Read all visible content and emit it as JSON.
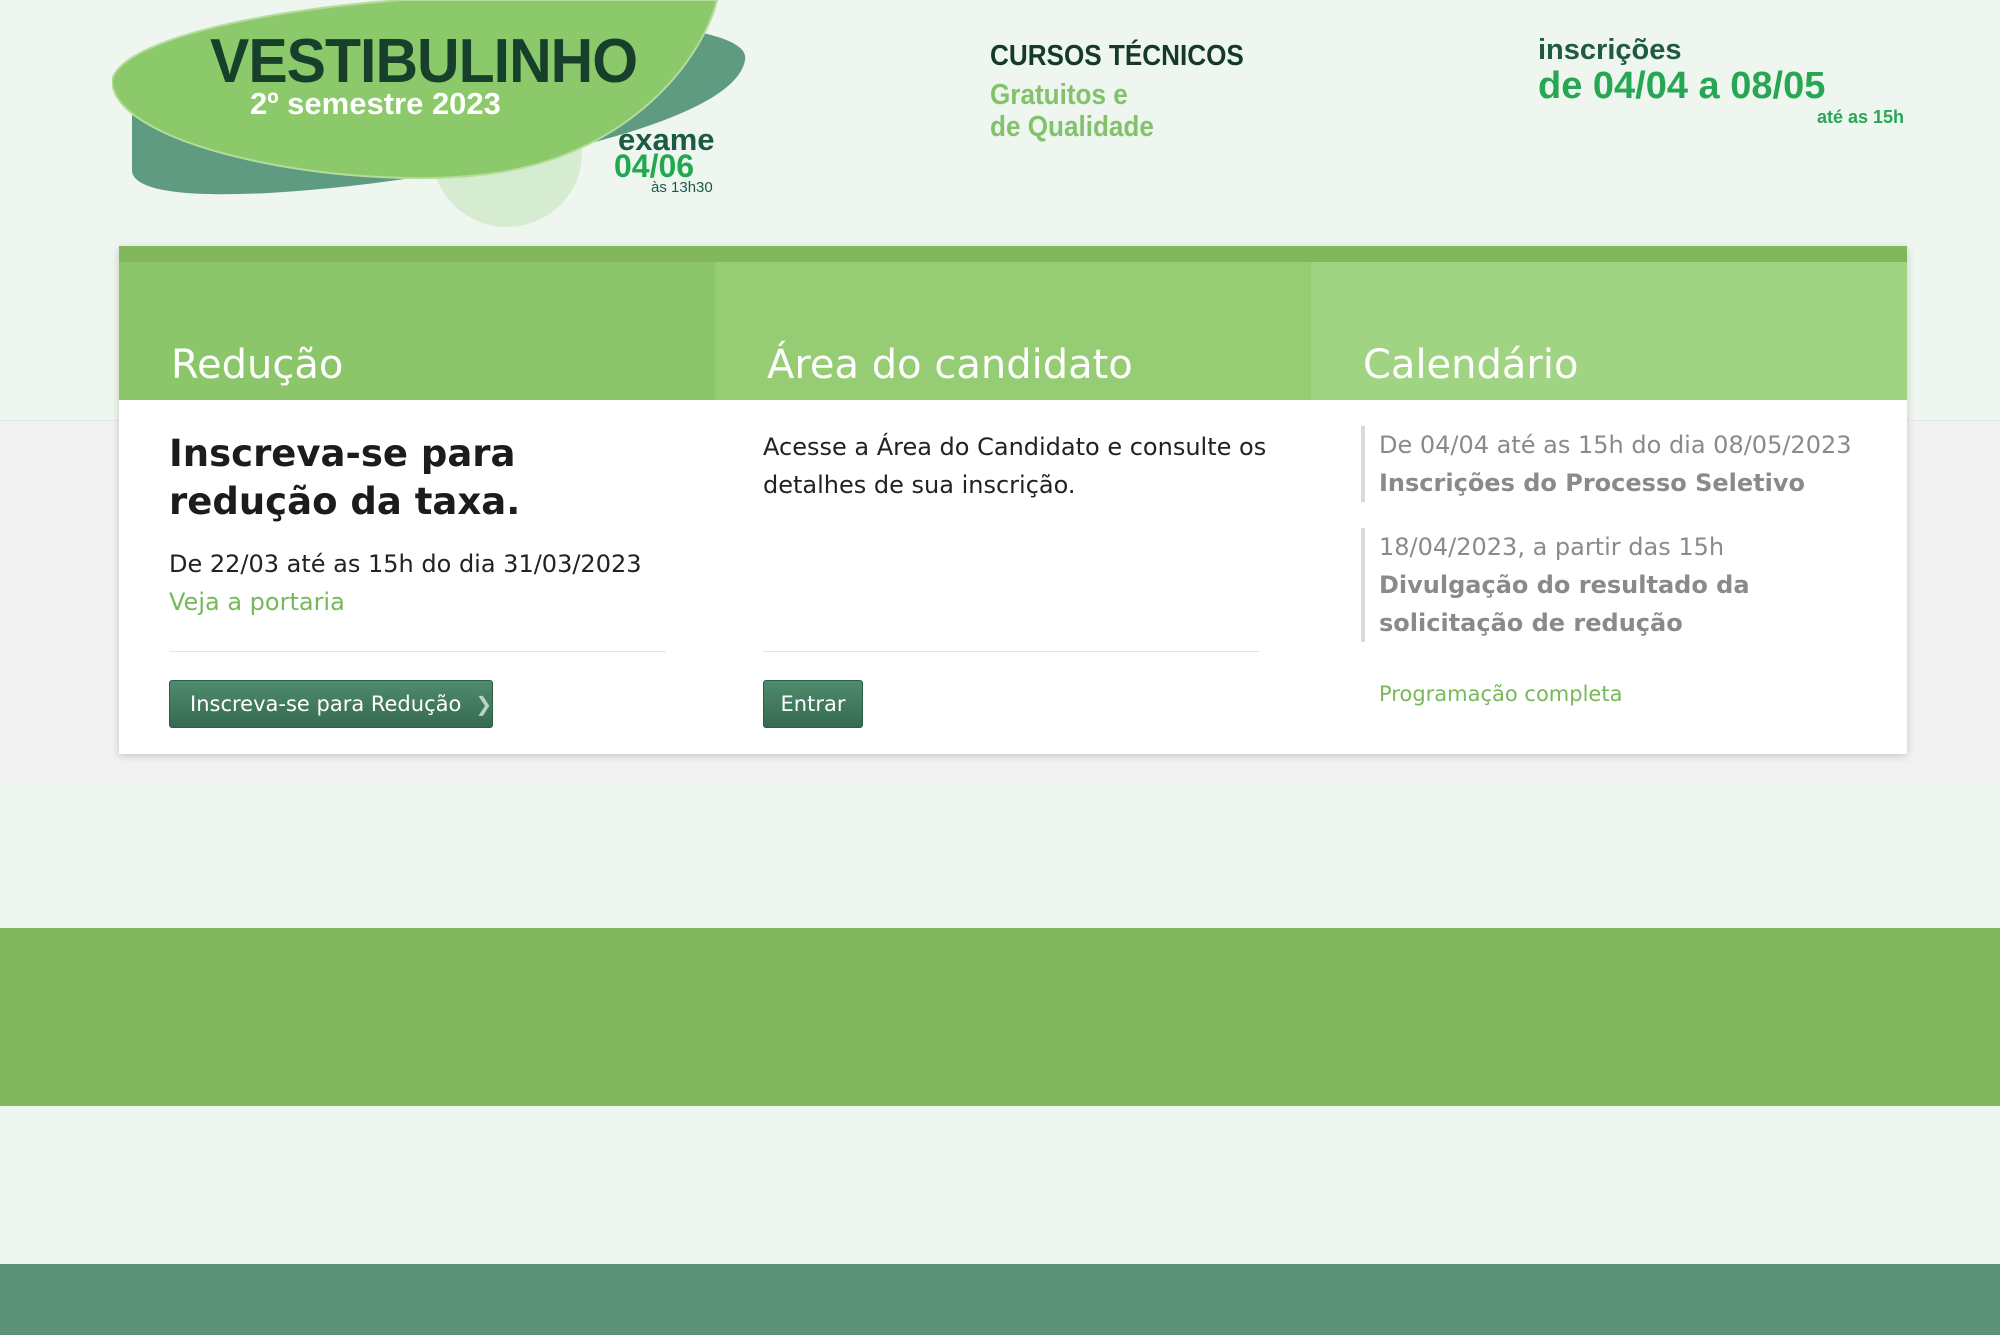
{
  "header": {
    "logo": {
      "title": "VESTIBULINHO",
      "subtitle": "2º semestre 2023",
      "exam_label": "exame",
      "exam_date": "04/06",
      "exam_time": "às 13h30"
    },
    "cursos": {
      "title": "CURSOS TÉCNICOS",
      "line2": "Gratuitos e",
      "line3": "de Qualidade"
    },
    "inscricoes": {
      "label": "inscrições",
      "dates": "de 04/04 a 08/05",
      "time": "até as 15h"
    }
  },
  "tabs": [
    {
      "title": "Redução"
    },
    {
      "title": "Área do candidato"
    },
    {
      "title": "Calendário"
    }
  ],
  "reducao": {
    "heading": "Inscreva-se para redução da taxa.",
    "period": "De 22/03 até as 15h do dia 31/03/2023",
    "link": "Veja a portaria",
    "button": "Inscreva-se para Redução"
  },
  "area": {
    "text": "Acesse a Área do Candidato e consulte os detalhes de sua inscrição.",
    "button": "Entrar"
  },
  "calendario": {
    "items": [
      {
        "date": "De 04/04 até as 15h do dia 08/05/2023",
        "desc": "Inscrições do Processo Seletivo"
      },
      {
        "date": "18/04/2023, a partir das 15h",
        "desc": "Divulgação do resultado da solicitação de redução"
      }
    ],
    "more_link": "Programação completa"
  },
  "colors": {
    "brand_dark": "#1f5a46",
    "brand_green": "#27a653",
    "tab_green": "#8cc66a",
    "band_green": "#81b55e",
    "footer": "#5a9178",
    "link": "#77b859"
  }
}
